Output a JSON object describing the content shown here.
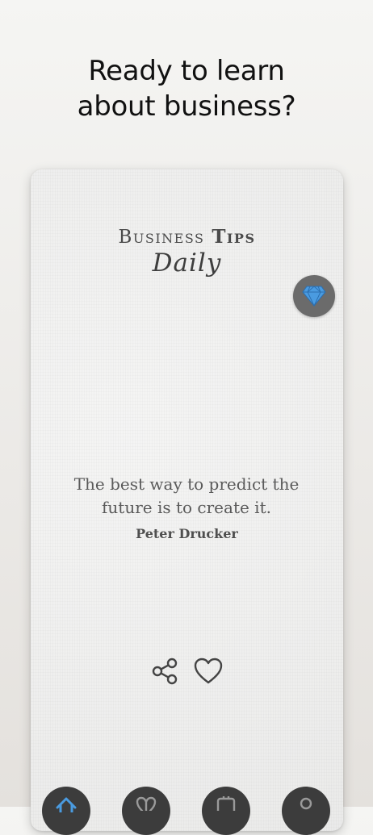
{
  "headline": {
    "line1": "Ready to learn",
    "line2": "about business?"
  },
  "brand": {
    "word1": "Business",
    "word2": "Tips",
    "sub": "Daily"
  },
  "quote": {
    "text": "The best way to predict the future is to create it.",
    "author": "Peter Drucker"
  },
  "icons": {
    "premium": "diamond-icon",
    "share": "share-icon",
    "like": "heart-icon",
    "tabs": [
      "home-icon",
      "heart-icon",
      "cards-icon",
      "profile-icon"
    ]
  },
  "colors": {
    "accent": "#4a9be0",
    "text_dark": "#111111",
    "card_bg": "#efefee",
    "tab_bg": "#3c3c3c"
  }
}
